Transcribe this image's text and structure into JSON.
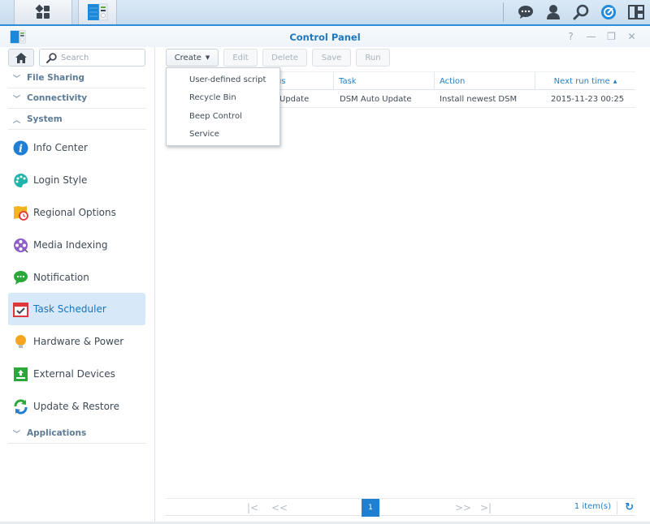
{
  "taskbar": {
    "buttons": [
      {
        "name": "main-menu",
        "icon": "apps-grid-icon"
      },
      {
        "name": "control-panel",
        "icon": "control-panel-icon"
      }
    ],
    "right_icons": [
      "chat-icon",
      "user-icon",
      "search-icon",
      "dashboard-icon",
      "widgets-icon"
    ]
  },
  "window": {
    "title": "Control Panel",
    "controls": {
      "help": "?",
      "minimize": "—",
      "restore": "❐",
      "close": "✕"
    }
  },
  "sidebar": {
    "search_placeholder": "Search",
    "categories": [
      {
        "label": "File Sharing",
        "expanded": false
      },
      {
        "label": "Connectivity",
        "expanded": false
      },
      {
        "label": "System",
        "expanded": true
      },
      {
        "label": "Applications",
        "expanded": false
      }
    ],
    "items": [
      {
        "label": "Info Center",
        "icon": "info-icon"
      },
      {
        "label": "Login Style",
        "icon": "palette-icon"
      },
      {
        "label": "Regional Options",
        "icon": "map-clock-icon"
      },
      {
        "label": "Media Indexing",
        "icon": "film-reel-icon"
      },
      {
        "label": "Notification",
        "icon": "chat-bubble-icon"
      },
      {
        "label": "Task Scheduler",
        "icon": "calendar-check-icon",
        "active": true
      },
      {
        "label": "Hardware & Power",
        "icon": "light-bulb-icon"
      },
      {
        "label": "External Devices",
        "icon": "upload-device-icon"
      },
      {
        "label": "Update & Restore",
        "icon": "refresh-arrows-icon"
      }
    ]
  },
  "toolbar": {
    "create": "Create",
    "edit": "Edit",
    "delete": "Delete",
    "save": "Save",
    "run": "Run"
  },
  "create_menu": {
    "items": [
      "User-defined script",
      "Recycle Bin",
      "Beep Control",
      "Service"
    ]
  },
  "grid": {
    "columns": [
      "us",
      "Task",
      "Action",
      "Next run time"
    ],
    "sort_indicator": "▲",
    "rows": [
      {
        "col1": "Update",
        "task": "DSM Auto Update",
        "action": "Install newest DSM",
        "next_run": "2015-11-23 00:25"
      }
    ]
  },
  "pager": {
    "first": "|<",
    "prev": "<<",
    "current_page": "1",
    "next": ">>",
    "last": ">|",
    "count": "1 item(s)",
    "refresh_icon": "refresh-icon"
  },
  "colors": {
    "accent": "#1f7fd1",
    "active_item_bg": "#d7e9f8",
    "category_text": "#5c7b96"
  }
}
